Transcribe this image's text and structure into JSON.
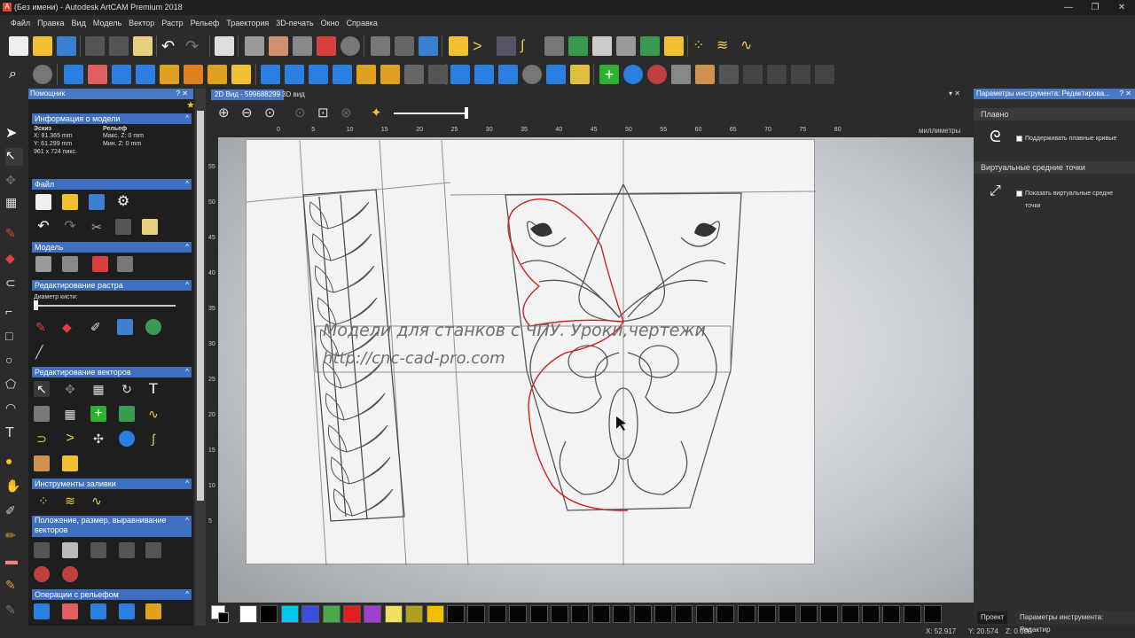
{
  "window": {
    "title": "(Без имени) - Autodesk ArtCAM Premium 2018",
    "app_icon_text": "A",
    "min_label": "—",
    "max_label": "❐",
    "close_label": "✕"
  },
  "menu": [
    "Файл",
    "Правка",
    "Вид",
    "Модель",
    "Вектор",
    "Растр",
    "Рельеф",
    "Траектория",
    "3D-печать",
    "Окно",
    "Справка"
  ],
  "helper_panel": {
    "title": "Помощник",
    "title_buttons": "? ✕",
    "model_info": {
      "header": "Информация о модели",
      "sketch_label": "Эскиз",
      "x": "X: 81.365 mm",
      "y": "Y: 61.299 mm",
      "pixels": "961 x 724 пикс.",
      "relief_label": "Рельеф",
      "max_z": "Макс. Z: 0 mm",
      "min_z": "Мин. Z: 0 mm"
    },
    "sections": {
      "file": "Файл",
      "model": "Модель",
      "raster_edit": "Редактирование растра",
      "brush_diameter": "Диаметр кисти:",
      "vector_edit": "Редактирование векторов",
      "fill_tools": "Инструменты заливки",
      "position": "Положение, размер, выравнивание векторов",
      "relief_ops": "Операции с рельефом"
    }
  },
  "tabs": {
    "view2d": "2D Вид - 599688299",
    "view3d": "3D вид"
  },
  "ruler": {
    "units": "миллиметры",
    "top_ticks": [
      "0",
      "5",
      "10",
      "15",
      "20",
      "25",
      "30",
      "35",
      "40",
      "45",
      "50",
      "55",
      "60",
      "65",
      "70",
      "75",
      "80"
    ],
    "left_ticks": [
      "55",
      "50",
      "45",
      "40",
      "35",
      "30",
      "25",
      "20",
      "15",
      "10",
      "5"
    ]
  },
  "watermark": {
    "line1": "Модели для станков с ЧПУ. Уроки,чертежи",
    "line2": "http://cnc-cad-pro.com"
  },
  "palette": {
    "colors": [
      "#ffffff",
      "#000000",
      "#00c8e8",
      "#3a4ee0",
      "#4ca84c",
      "#e02020",
      "#a040d0",
      "#f0e060",
      "#b0a020",
      "#f0c000"
    ],
    "empty_count": 24,
    "empty_color": "#050505"
  },
  "status": {
    "x": "X: 52.917",
    "y": "Y: 20.574",
    "z": "Z: 0.000"
  },
  "right_panel": {
    "title": "Параметры инструмента: Редактирова...",
    "title_buttons": "? ✕",
    "smooth_header": "Плавно",
    "smooth_option": "Поддерживать плавные кривые",
    "virtual_header": "Виртуальные средние точки",
    "virtual_option_line1": "Показать виртуальные средне",
    "virtual_option_line2": "точки",
    "tab_project": "Проект",
    "tab_params": "Параметры инструмента: Редактир"
  },
  "accent_color": "#4a78c2"
}
